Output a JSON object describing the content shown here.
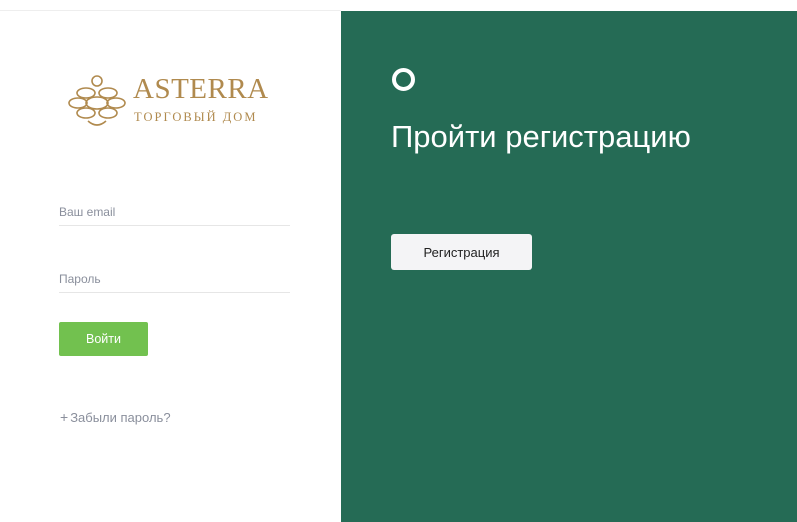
{
  "colors": {
    "brand_gold": "#b08a4e",
    "login_green": "#72c14f",
    "panel_dark_green": "#256b55"
  },
  "logo": {
    "title": "ASTERRA",
    "subtitle": "ТОРГОВЫЙ ДОМ",
    "icon": "ornament-knot-icon"
  },
  "login": {
    "email_placeholder": "Ваш email",
    "password_placeholder": "Пароль",
    "submit_label": "Войти",
    "forgot_plus": "+",
    "forgot_label": "Забыли пароль?"
  },
  "register": {
    "icon": "circle-icon",
    "heading": "Пройти регистрацию",
    "button_label": "Регистрация"
  }
}
